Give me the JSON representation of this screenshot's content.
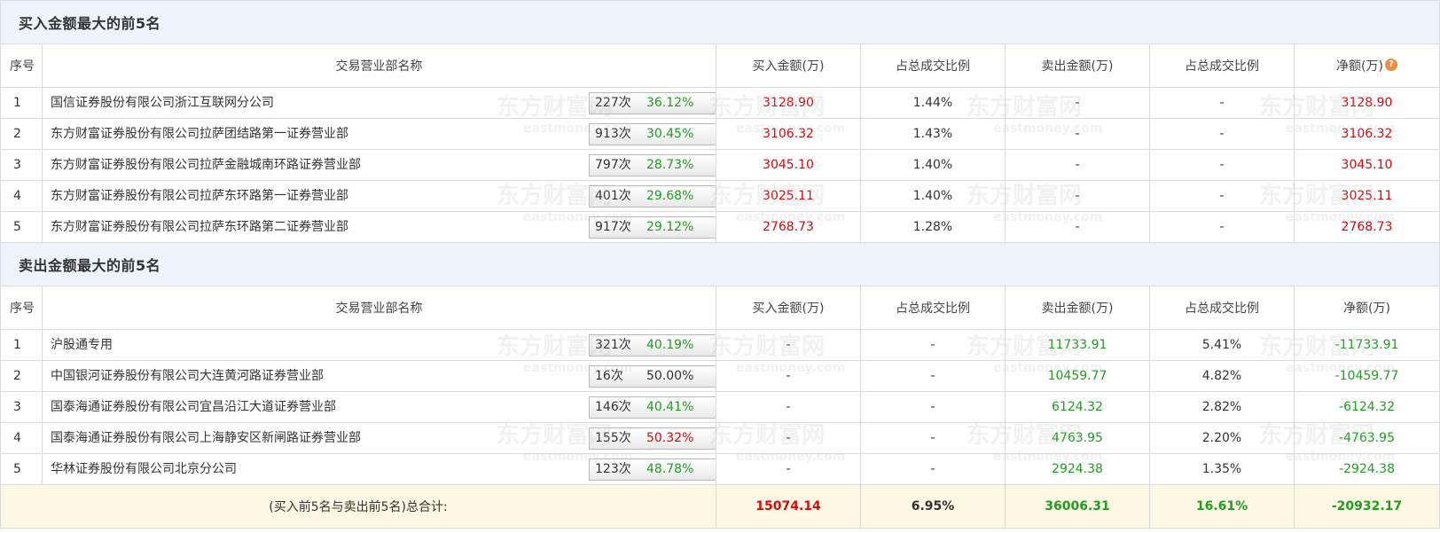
{
  "buy_section": {
    "title": "买入金额最大的前5名",
    "headers": {
      "seq": "序号",
      "name": "交易营业部名称",
      "buy": "买入金额(万)",
      "buy_ratio": "占总成交比例",
      "sell": "卖出金额(万)",
      "sell_ratio": "占总成交比例",
      "net": "净额(万)"
    },
    "rows": [
      {
        "seq": "1",
        "name": "国信证券股份有限公司浙江互联网分公司",
        "count": "227次",
        "pct": "36.12%",
        "pct_color": "green",
        "icon": "question-icon",
        "buy": "3128.90",
        "buy_ratio": "1.44%",
        "sell": "-",
        "sell_ratio": "-",
        "net": "3128.90"
      },
      {
        "seq": "2",
        "name": "东方财富证券股份有限公司拉萨团结路第一证券营业部",
        "count": "913次",
        "pct": "30.45%",
        "pct_color": "green",
        "icon": "play-arrow-icon",
        "buy": "3106.32",
        "buy_ratio": "1.43%",
        "sell": "-",
        "sell_ratio": "-",
        "net": "3106.32"
      },
      {
        "seq": "3",
        "name": "东方财富证券股份有限公司拉萨金融城南环路证券营业部",
        "count": "797次",
        "pct": "28.73%",
        "pct_color": "green",
        "icon": "play-arrow-icon",
        "buy": "3045.10",
        "buy_ratio": "1.40%",
        "sell": "-",
        "sell_ratio": "-",
        "net": "3045.10"
      },
      {
        "seq": "4",
        "name": "东方财富证券股份有限公司拉萨东环路第一证券营业部",
        "count": "401次",
        "pct": "29.68%",
        "pct_color": "green",
        "icon": "play-arrow-icon",
        "buy": "3025.11",
        "buy_ratio": "1.40%",
        "sell": "-",
        "sell_ratio": "-",
        "net": "3025.11"
      },
      {
        "seq": "5",
        "name": "东方财富证券股份有限公司拉萨东环路第二证券营业部",
        "count": "917次",
        "pct": "29.12%",
        "pct_color": "green",
        "icon": "play-arrow-icon",
        "buy": "2768.73",
        "buy_ratio": "1.28%",
        "sell": "-",
        "sell_ratio": "-",
        "net": "2768.73"
      }
    ]
  },
  "sell_section": {
    "title": "卖出金额最大的前5名",
    "headers": {
      "seq": "序号",
      "name": "交易营业部名称",
      "buy": "买入金额(万)",
      "buy_ratio": "占总成交比例",
      "sell": "卖出金额(万)",
      "sell_ratio": "占总成交比例",
      "net": "净额(万)"
    },
    "rows": [
      {
        "seq": "1",
        "name": "沪股通专用",
        "count": "321次",
        "pct": "40.19%",
        "pct_color": "green",
        "icon": "question-icon",
        "buy": "-",
        "buy_ratio": "-",
        "sell": "11733.91",
        "sell_ratio": "5.41%",
        "net": "-11733.91"
      },
      {
        "seq": "2",
        "name": "中国银河证券股份有限公司大连黄河路证券营业部",
        "count": "16次",
        "pct": "50.00%",
        "pct_color": "black",
        "icon": "play-arrow-icon",
        "buy": "-",
        "buy_ratio": "-",
        "sell": "10459.77",
        "sell_ratio": "4.82%",
        "net": "-10459.77"
      },
      {
        "seq": "3",
        "name": "国泰海通证券股份有限公司宜昌沿江大道证券营业部",
        "count": "146次",
        "pct": "40.41%",
        "pct_color": "green",
        "icon": "play-arrow-icon",
        "buy": "-",
        "buy_ratio": "-",
        "sell": "6124.32",
        "sell_ratio": "2.82%",
        "net": "-6124.32"
      },
      {
        "seq": "4",
        "name": "国泰海通证券股份有限公司上海静安区新闸路证券营业部",
        "count": "155次",
        "pct": "50.32%",
        "pct_color": "red",
        "icon": "play-arrow-icon",
        "buy": "-",
        "buy_ratio": "-",
        "sell": "4763.95",
        "sell_ratio": "2.20%",
        "net": "-4763.95"
      },
      {
        "seq": "5",
        "name": "华林证券股份有限公司北京分公司",
        "count": "123次",
        "pct": "48.78%",
        "pct_color": "green",
        "icon": "play-arrow-icon",
        "buy": "-",
        "buy_ratio": "-",
        "sell": "2924.38",
        "sell_ratio": "1.35%",
        "net": "-2924.38"
      }
    ]
  },
  "total": {
    "label": "(买入前5名与卖出前5名)总合计:",
    "buy": "15074.14",
    "buy_ratio": "6.95%",
    "sell": "36006.31",
    "sell_ratio": "16.61%",
    "net": "-20932.17"
  },
  "watermark": {
    "cn": "东方财富网",
    "en": "eastmoney.com"
  },
  "colors": {
    "red": "#d40b0b",
    "green": "#1f9e1f",
    "title_bg": "#eef4fb",
    "total_bg": "#fcf8e3",
    "icon_orange": "#f08a3c"
  }
}
